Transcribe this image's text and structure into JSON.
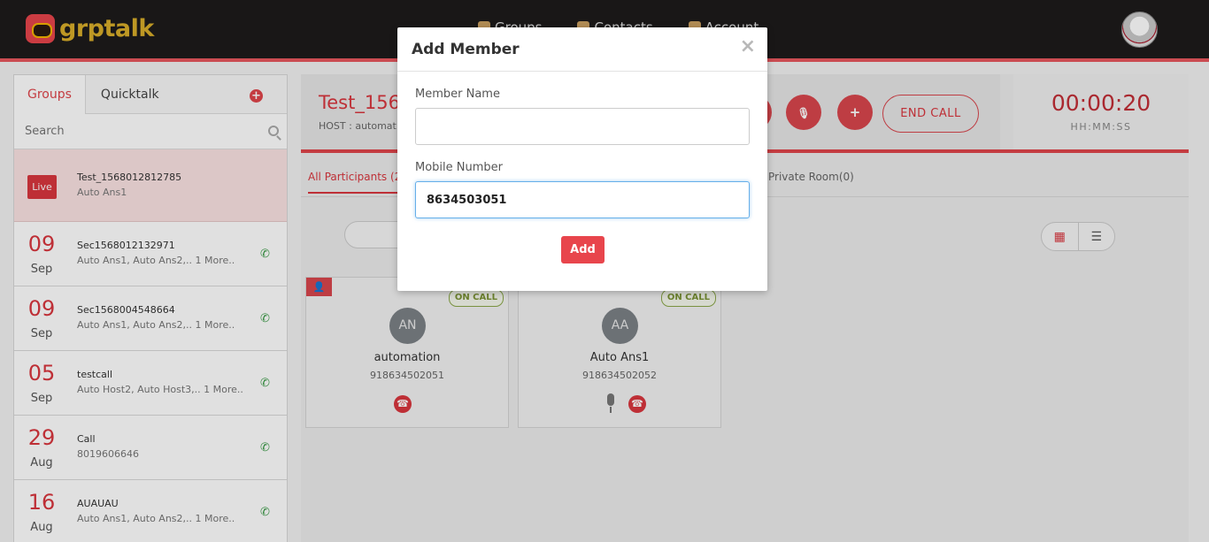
{
  "app": {
    "logo_text": "grptalk"
  },
  "nav": {
    "items": [
      "Groups",
      "Contacts",
      "Account"
    ]
  },
  "sidebar": {
    "tabs": {
      "groups": "Groups",
      "quicktalk": "Quicktalk"
    },
    "search_placeholder": "Search",
    "live": {
      "badge": "Live",
      "title": "Test_1568012812785",
      "subtitle": "Auto Ans1"
    },
    "groups": [
      {
        "day": "09",
        "month": "Sep",
        "title": "Sec1568012132971",
        "subtitle": "Auto Ans1, Auto Ans2,.. 1 More.."
      },
      {
        "day": "09",
        "month": "Sep",
        "title": "Sec1568004548664",
        "subtitle": "Auto Ans1, Auto Ans2,.. 1 More.."
      },
      {
        "day": "05",
        "month": "Sep",
        "title": "testcall",
        "subtitle": "Auto Host2, Auto Host3,.. 1 More.."
      },
      {
        "day": "29",
        "month": "Aug",
        "title": "Call",
        "subtitle": "8019606646"
      },
      {
        "day": "16",
        "month": "Aug",
        "title": "AUAUAU",
        "subtitle": "Auto Ans1, Auto Ans2,.. 1 More.."
      }
    ]
  },
  "call": {
    "title": "Test_156",
    "host": "HOST : automat",
    "end_call": "END CALL",
    "timer": "00:00:20",
    "timer_label": "HH:MM:SS",
    "tab_all": "All Participants (2",
    "tab_private": "Private Room(0)"
  },
  "participants": [
    {
      "initials": "AN",
      "name": "automation",
      "number": "918634502051",
      "status": "ON CALL"
    },
    {
      "initials": "AA",
      "name": "Auto Ans1",
      "number": "918634502052",
      "status": "ON CALL"
    }
  ],
  "modal": {
    "title": "Add Member",
    "close": "×",
    "name_label": "Member Name",
    "name_value": "",
    "mobile_label": "Mobile Number",
    "mobile_value": "8634503051",
    "add_label": "Add"
  },
  "icons": {
    "plus": "+",
    "phone": "✆",
    "hangup": "☎",
    "user": "👤",
    "grid": "▦",
    "list": "☰",
    "mute": "🎙"
  }
}
